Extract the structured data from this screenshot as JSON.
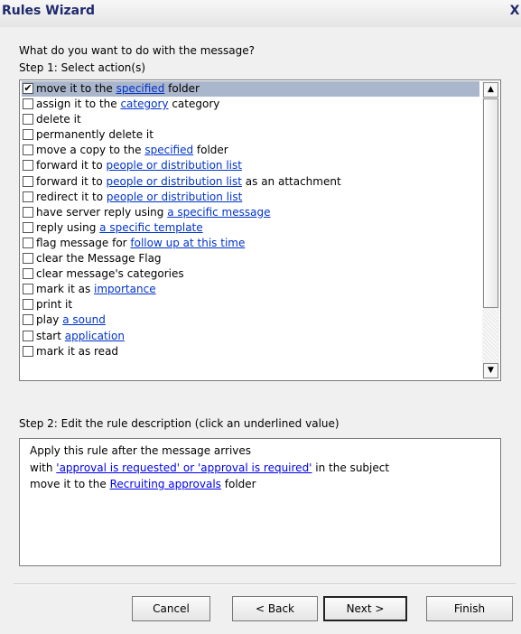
{
  "window": {
    "title": "Rules Wizard",
    "close_glyph": "X"
  },
  "prompt": "What do you want to do with the message?",
  "step1_label": "Step 1: Select action(s)",
  "actions": [
    {
      "checked": true,
      "selected": true,
      "segments": [
        {
          "t": "move it to the "
        },
        {
          "t": "specified",
          "link": true
        },
        {
          "t": " folder"
        }
      ]
    },
    {
      "checked": false,
      "segments": [
        {
          "t": "assign it to the "
        },
        {
          "t": "category",
          "link": true
        },
        {
          "t": " category"
        }
      ]
    },
    {
      "checked": false,
      "segments": [
        {
          "t": "delete it"
        }
      ]
    },
    {
      "checked": false,
      "segments": [
        {
          "t": "permanently delete it"
        }
      ]
    },
    {
      "checked": false,
      "segments": [
        {
          "t": "move a copy to the "
        },
        {
          "t": "specified",
          "link": true
        },
        {
          "t": " folder"
        }
      ]
    },
    {
      "checked": false,
      "segments": [
        {
          "t": "forward it to "
        },
        {
          "t": "people or distribution list",
          "link": true
        }
      ]
    },
    {
      "checked": false,
      "segments": [
        {
          "t": "forward it to "
        },
        {
          "t": "people or distribution list",
          "link": true
        },
        {
          "t": " as an attachment"
        }
      ]
    },
    {
      "checked": false,
      "segments": [
        {
          "t": "redirect it to "
        },
        {
          "t": "people or distribution list",
          "link": true
        }
      ]
    },
    {
      "checked": false,
      "segments": [
        {
          "t": "have server reply using "
        },
        {
          "t": "a specific message",
          "link": true
        }
      ]
    },
    {
      "checked": false,
      "segments": [
        {
          "t": "reply using "
        },
        {
          "t": "a specific template",
          "link": true
        }
      ]
    },
    {
      "checked": false,
      "segments": [
        {
          "t": "flag message for "
        },
        {
          "t": "follow up at this time",
          "link": true
        }
      ]
    },
    {
      "checked": false,
      "segments": [
        {
          "t": "clear the Message Flag"
        }
      ]
    },
    {
      "checked": false,
      "segments": [
        {
          "t": "clear message's categories"
        }
      ]
    },
    {
      "checked": false,
      "segments": [
        {
          "t": "mark it as "
        },
        {
          "t": "importance",
          "link": true
        }
      ]
    },
    {
      "checked": false,
      "segments": [
        {
          "t": "print it"
        }
      ]
    },
    {
      "checked": false,
      "segments": [
        {
          "t": "play "
        },
        {
          "t": "a sound",
          "link": true
        }
      ]
    },
    {
      "checked": false,
      "segments": [
        {
          "t": "start "
        },
        {
          "t": "application",
          "link": true
        }
      ]
    },
    {
      "checked": false,
      "segments": [
        {
          "t": "mark it as read"
        }
      ]
    }
  ],
  "step2_label": "Step 2: Edit the rule description (click an underlined value)",
  "description": [
    [
      {
        "t": "Apply this rule after the message arrives"
      }
    ],
    [
      {
        "t": "with "
      },
      {
        "t": "'approval is requested' or 'approval is required'",
        "link": true
      },
      {
        "t": " in the subject"
      }
    ],
    [
      {
        "t": "move it to the "
      },
      {
        "t": "Recruiting approvals",
        "link": true
      },
      {
        "t": " folder"
      }
    ]
  ],
  "buttons": {
    "cancel": "Cancel",
    "back": "< Back",
    "next": "Next >",
    "finish": "Finish"
  },
  "icons": {
    "scroll_up": "scroll-up-arrow-icon",
    "scroll_down": "scroll-down-arrow-icon",
    "check": "checkmark-icon"
  }
}
